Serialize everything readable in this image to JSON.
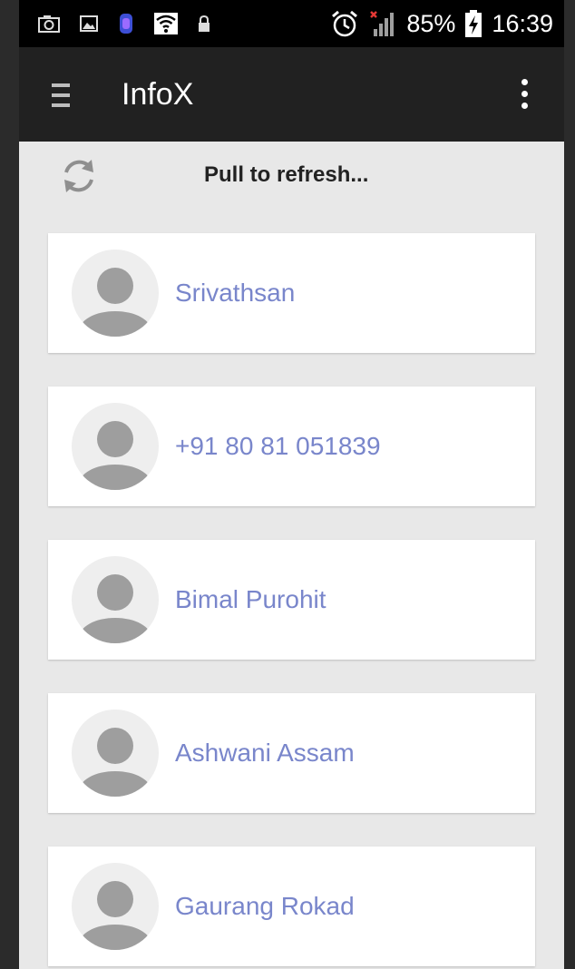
{
  "status_bar": {
    "battery_percent": "85%",
    "time": "16:39",
    "icons": [
      "camera-icon",
      "image-icon",
      "app-notification-icon",
      "wifi-icon",
      "lock-icon",
      "alarm-icon",
      "signal-icon",
      "battery-icon"
    ]
  },
  "toolbar": {
    "title": "InfoX",
    "menu_icon": "hamburger-icon",
    "overflow_icon": "more-vert-icon"
  },
  "refresh": {
    "label": "Pull to refresh...",
    "icon": "refresh-icon"
  },
  "contacts": [
    {
      "name": "Srivathsan"
    },
    {
      "name": "+91 80 81 051839"
    },
    {
      "name": "Bimal Purohit"
    },
    {
      "name": "Ashwani Assam"
    },
    {
      "name": "Gaurang Rokad"
    }
  ],
  "colors": {
    "toolbar": "#212121",
    "status_bar": "#000000",
    "background": "#e8e8e8",
    "contact_name": "#7986cb",
    "avatar_bg": "#eeeeee",
    "avatar_fg": "#9e9e9e"
  }
}
